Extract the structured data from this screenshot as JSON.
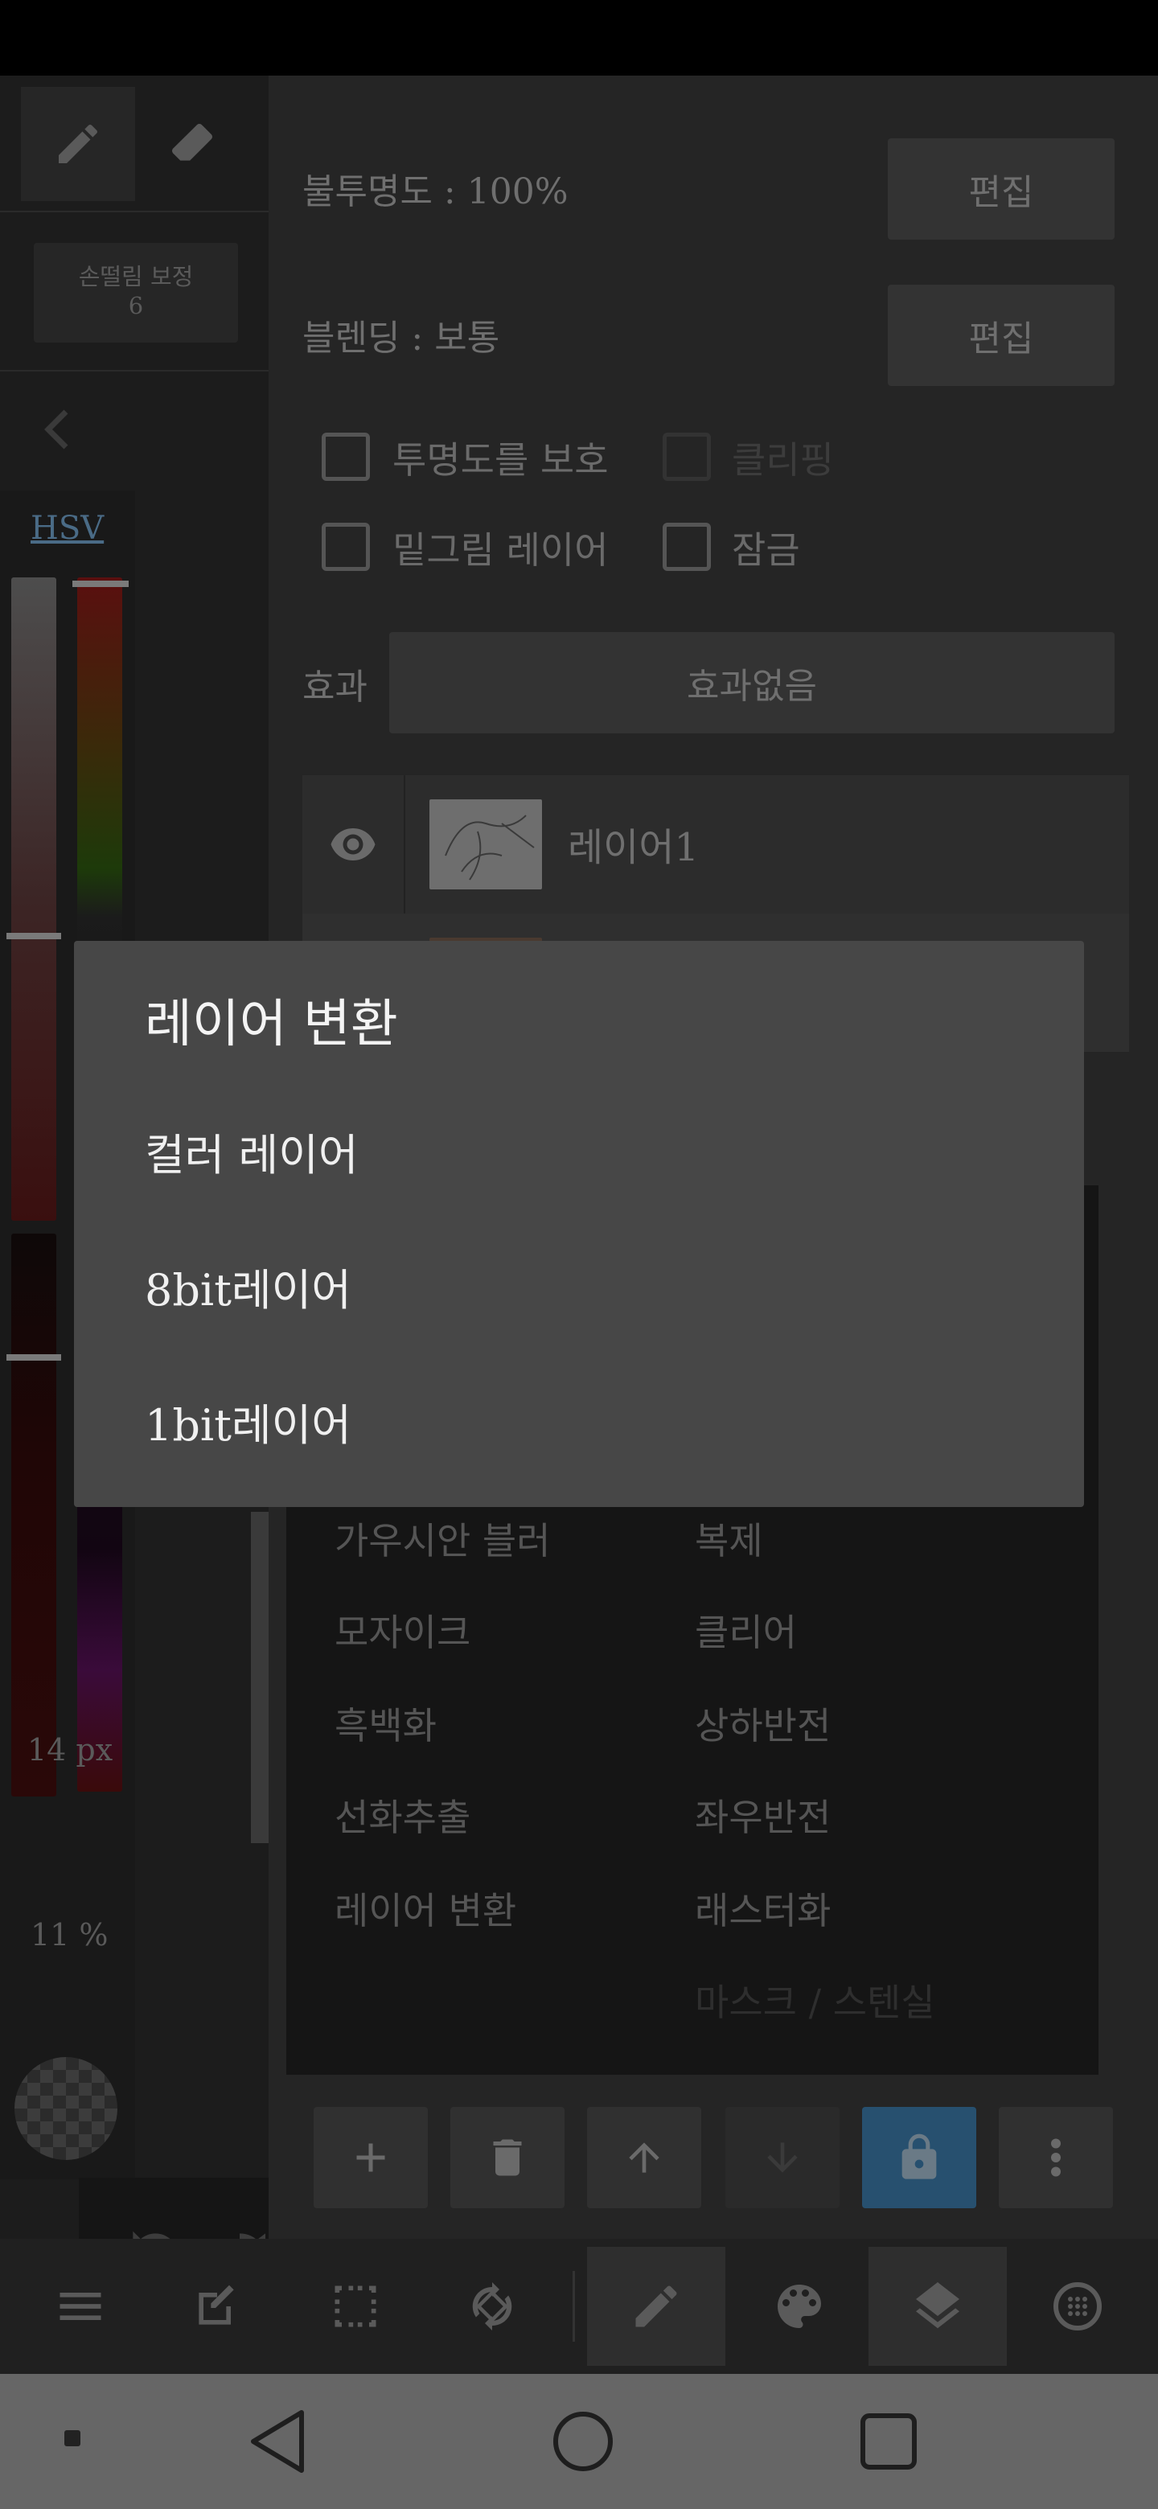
{
  "left_panel": {
    "stabilizer_label": "손떨림 보정",
    "stabilizer_value": "6",
    "color_mode_tab": "HSV",
    "brush_size": "14 px",
    "brush_opacity": "11 %"
  },
  "layer_panel": {
    "opacity_label": "불투명도 : 100%",
    "opacity_edit_button": "편집",
    "blending_label": "블렌딩 : 보통",
    "blending_edit_button": "편집",
    "checkboxes": {
      "protect_alpha": "투명도를 보호",
      "clipping": "클리핑",
      "draft_layer": "밑그림 레이어",
      "lock": "잠금"
    },
    "effect_label": "효과",
    "effect_value": "효과없음",
    "layers": [
      {
        "name": "레이어1",
        "visible": true
      }
    ]
  },
  "layer_menu": {
    "left_items": [
      "가우시안 블러",
      "모자이크",
      "흑백화",
      "선화추출",
      "레이어 변환"
    ],
    "right_items": [
      "복제",
      "클리어",
      "상하반전",
      "좌우반전",
      "래스터화",
      "마스크 / 스텐실"
    ]
  },
  "dialog": {
    "title": "레이어 변환",
    "options": [
      "컬러 레이어",
      "8bit레이어",
      "1bit레이어"
    ]
  },
  "toolbar": {
    "items": [
      "menu-icon",
      "edit-icon",
      "selection-icon",
      "rotate-icon",
      "pen-icon",
      "palette-icon",
      "layers-icon",
      "navigator-icon"
    ],
    "selected": [
      "pen-icon",
      "layers-icon"
    ]
  },
  "colors": {
    "accent_lock": "#27506f",
    "hsv_tab": "#4a6b86",
    "dialog_bg": "#474747"
  }
}
